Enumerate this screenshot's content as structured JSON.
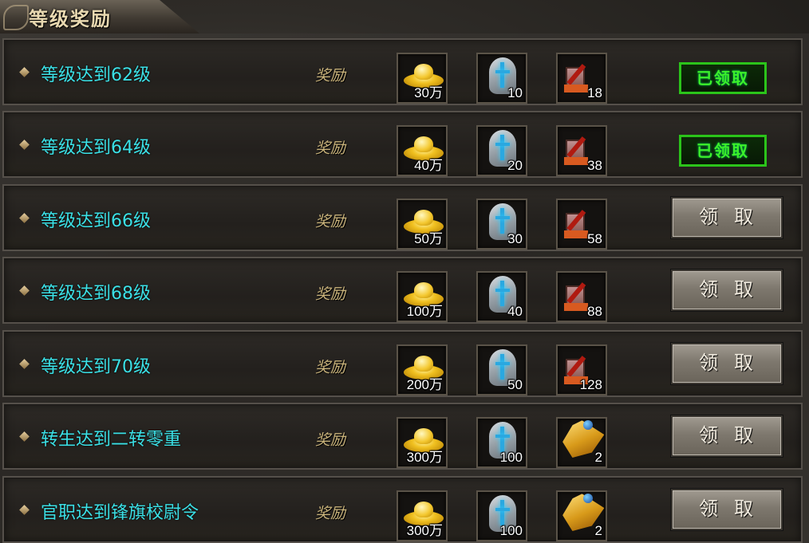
{
  "header": {
    "title": "等级奖励"
  },
  "reward_label": "奖励",
  "claimed_label": "已领取",
  "claim_label": "领取",
  "rows": [
    {
      "title": "等级达到62级",
      "gold": "30万",
      "stone": "10",
      "third": "18",
      "third_icon": "hammer-icon",
      "status": "claimed"
    },
    {
      "title": "等级达到64级",
      "gold": "40万",
      "stone": "20",
      "third": "38",
      "third_icon": "hammer-icon",
      "status": "claimed"
    },
    {
      "title": "等级达到66级",
      "gold": "50万",
      "stone": "30",
      "third": "58",
      "third_icon": "hammer-icon",
      "status": "claim"
    },
    {
      "title": "等级达到68级",
      "gold": "100万",
      "stone": "40",
      "third": "88",
      "third_icon": "hammer-icon",
      "status": "claim"
    },
    {
      "title": "等级达到70级",
      "gold": "200万",
      "stone": "50",
      "third": "128",
      "third_icon": "hammer-icon",
      "status": "claim"
    },
    {
      "title": "转生达到二转零重",
      "gold": "300万",
      "stone": "100",
      "third": "2",
      "third_icon": "shield-icon",
      "status": "claim"
    },
    {
      "title": "官职达到锋旗校尉令",
      "gold": "300万",
      "stone": "100",
      "third": "2",
      "third_icon": "shield-icon",
      "status": "claim"
    }
  ],
  "colors": {
    "row_title": "#3be0e6",
    "claimed_green": "#2bc41a",
    "reward_label": "#c8b27a"
  }
}
